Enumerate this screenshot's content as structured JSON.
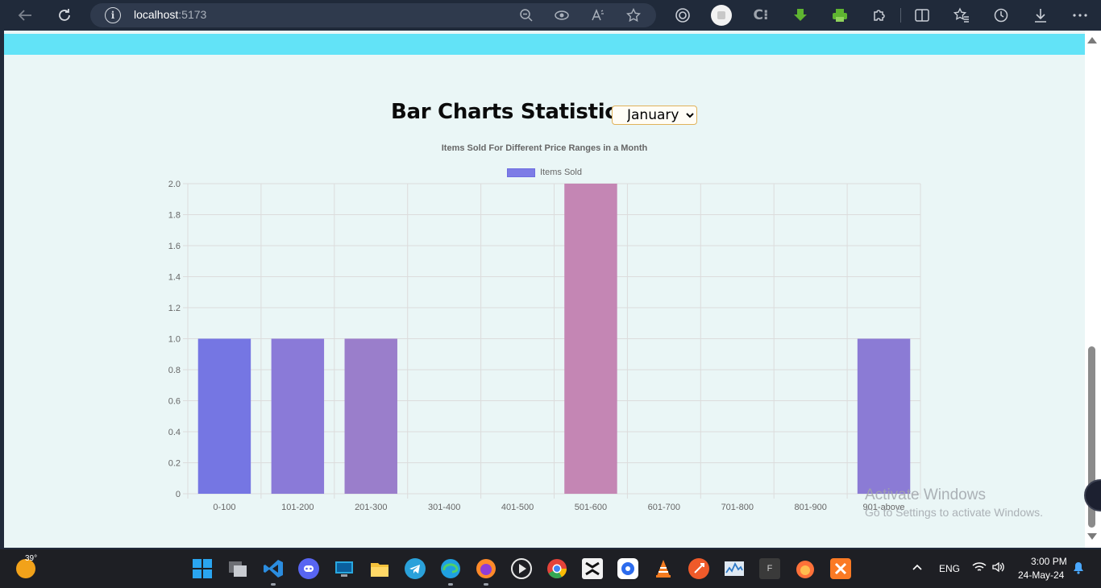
{
  "browser": {
    "url_host": "localhost",
    "url_port": ":5173"
  },
  "page": {
    "heading": "Bar Charts Statistics -",
    "month_select": {
      "selected": "January"
    }
  },
  "chart_data": {
    "type": "bar",
    "title": "Items Sold For Different Price Ranges in a Month",
    "categories": [
      "0-100",
      "101-200",
      "201-300",
      "301-400",
      "401-500",
      "501-600",
      "601-700",
      "701-800",
      "801-900",
      "901-above"
    ],
    "series": [
      {
        "name": "Items Sold",
        "values": [
          1,
          1,
          1,
          0,
          0,
          2,
          0,
          0,
          0,
          1
        ]
      }
    ],
    "bar_colors": [
      "#7576e3",
      "#8a7ad8",
      "#9a7ecb",
      "#a982c0",
      "#b684b8",
      "#c486b4",
      "#b884bb",
      "#a882c4",
      "#9a80ce",
      "#8b7bd5"
    ],
    "y_ticks": [
      "0",
      "0.2",
      "0.4",
      "0.6",
      "0.8",
      "1.0",
      "1.2",
      "1.4",
      "1.6",
      "1.8",
      "2.0"
    ],
    "ylim": [
      0,
      2
    ],
    "grid": true,
    "legend_position": "top"
  },
  "watermark": {
    "line1": "Activate Windows",
    "line2": "Go to Settings to activate Windows."
  },
  "taskbar": {
    "weather_temp": "39°",
    "language": "ENG",
    "time": "3:00 PM",
    "date": "24-May-24"
  }
}
